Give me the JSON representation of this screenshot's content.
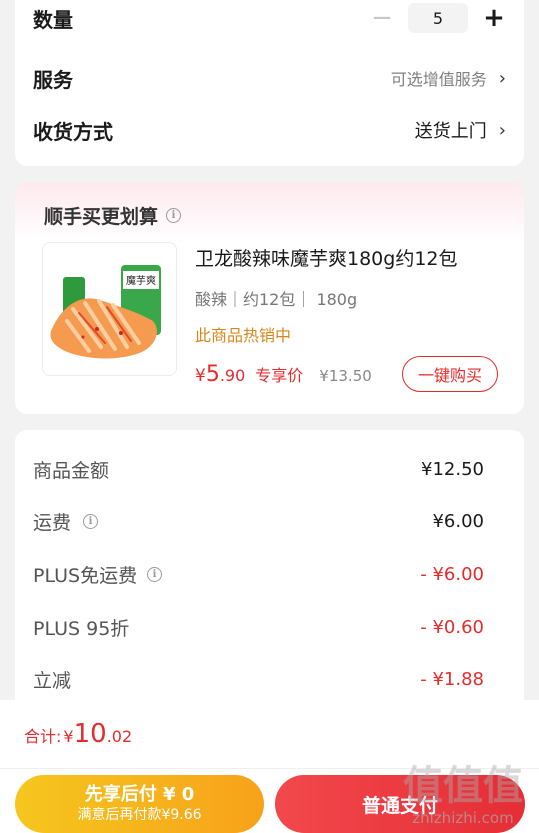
{
  "order": {
    "quantity_label": "数量",
    "quantity_value": "5",
    "service_label": "服务",
    "service_value": "可选增值服务",
    "delivery_label": "收货方式",
    "delivery_value": "送货上门"
  },
  "recommend": {
    "title": "顺手买更划算",
    "product": {
      "name": "卫龙酸辣味魔芋爽180g约12包",
      "spec": "酸辣｜约12包｜ 180g",
      "hot": "此商品热销中",
      "price_symbol": "¥",
      "price_int": "5",
      "price_dec": ".90",
      "price_tag": "专享价",
      "price_original": "¥13.50",
      "buy_label": "一键购买",
      "package_text": "魔芋爽"
    }
  },
  "summary": {
    "rows": [
      {
        "label": "商品金额",
        "value": "¥12.50"
      },
      {
        "label": "运费",
        "value": "¥6.00"
      },
      {
        "label": "PLUS免运费",
        "value": "- ¥6.00"
      },
      {
        "label": "PLUS 95折",
        "value": "- ¥0.60"
      },
      {
        "label": "立减",
        "value": "- ¥1.88"
      }
    ]
  },
  "bottom": {
    "total_label": "合计:",
    "total_symbol": "¥",
    "total_int": "10",
    "total_dec": ".02",
    "later_main": "先享后付 ¥ 0",
    "later_sub": "满意后再付款¥9.66",
    "pay_label": "普通支付"
  },
  "watermark": {
    "chars": "值值值",
    "url": "zhizhizhi.com"
  },
  "colors": {
    "accent_red": "#e52c2c",
    "hot_orange": "#d8871d",
    "later_gradient": [
      "#f6c61e",
      "#f7a21a"
    ],
    "pay_gradient": [
      "#f2484c",
      "#e52d36"
    ]
  }
}
